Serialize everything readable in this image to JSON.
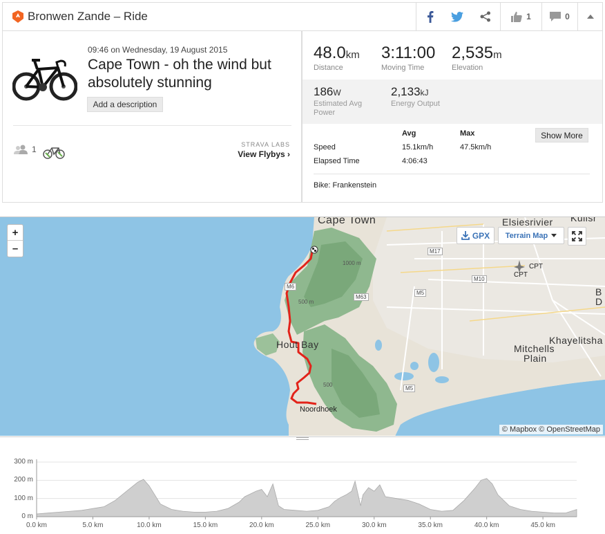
{
  "header": {
    "title": "Bronwen Zande – Ride",
    "kudos_count": "1",
    "comments_count": "0"
  },
  "activity": {
    "date": "09:46 on Wednesday, 19 August 2015",
    "name": "Cape Town - oh the wind but absolutely stunning",
    "add_description": "Add a description",
    "athlete_count": "1",
    "labs_label": "STRAVA LABS",
    "flyby_label": "View Flybys ›"
  },
  "stats": {
    "distance": {
      "value": "48.0",
      "unit": "km",
      "label": "Distance"
    },
    "moving_time": {
      "value": "3:11:00",
      "label": "Moving Time"
    },
    "elevation": {
      "value": "2,535",
      "unit": "m",
      "label": "Elevation"
    },
    "power": {
      "value": "186",
      "unit": "W",
      "label": "Estimated Avg Power"
    },
    "energy": {
      "value": "2,133",
      "unit": "kJ",
      "label": "Energy Output"
    }
  },
  "more_table": {
    "col_avg": "Avg",
    "col_max": "Max",
    "speed_label": "Speed",
    "speed_avg": "15.1km/h",
    "speed_max": "47.5km/h",
    "elapsed_label": "Elapsed Time",
    "elapsed_avg": "4:06:43",
    "show_more": "Show More",
    "bike": "Bike: Frankenstein"
  },
  "map": {
    "zoom_in": "+",
    "zoom_out": "–",
    "gpx": "GPX",
    "terrain": "Terrain Map",
    "attribution": "© Mapbox © OpenStreetMap",
    "labels": {
      "cape_town": "Cape Town",
      "elsiesrivier": "Elsiesrivier",
      "kuilsr": "Kuilsr",
      "hout_bay": "Hout Bay",
      "noordhoek": "Noordhoek",
      "khayelitsha": "Khayelitsha",
      "mitchells": "Mitchells",
      "plain": "Plain",
      "cpt1": "CPT",
      "cpt2": "CPT",
      "b": "B",
      "d": "D",
      "m17": "M17",
      "m10": "M10",
      "m5": "M5",
      "m5b": "M5",
      "m63": "M63",
      "m6": "M6",
      "e1000": "1000 m",
      "e500a": "500 m",
      "e500b": "500"
    }
  },
  "elevation_chart": {
    "y_ticks": [
      "300 m",
      "200 m",
      "100 m",
      "0 m"
    ],
    "x_ticks": [
      "0.0 km",
      "5.0 km",
      "10.0 km",
      "15.0 km",
      "20.0 km",
      "25.0 km",
      "30.0 km",
      "35.0 km",
      "40.0 km",
      "45.0 km"
    ],
    "y_max": 300,
    "x_max_km": 48.0,
    "profile_km": [
      0,
      1,
      2,
      3,
      4,
      5,
      6,
      7,
      8,
      9,
      9.5,
      10,
      10.5,
      11,
      12,
      13,
      14,
      15,
      16,
      17,
      18,
      18.5,
      19,
      19.5,
      20,
      20.5,
      21,
      21.5,
      22,
      23,
      24,
      25,
      26,
      26.5,
      27,
      27.5,
      28,
      28.3,
      28.8,
      29,
      29.5,
      30,
      30.5,
      31,
      32,
      33,
      34,
      35,
      36,
      37,
      38,
      39,
      39.5,
      40,
      40.5,
      41,
      42,
      43,
      44,
      45,
      46,
      47,
      48
    ],
    "profile_m": [
      15,
      20,
      25,
      30,
      35,
      45,
      55,
      90,
      140,
      190,
      205,
      170,
      120,
      70,
      40,
      30,
      25,
      25,
      30,
      45,
      80,
      110,
      125,
      140,
      150,
      110,
      180,
      60,
      40,
      35,
      30,
      35,
      55,
      85,
      105,
      120,
      140,
      195,
      60,
      120,
      160,
      140,
      175,
      110,
      100,
      90,
      70,
      40,
      30,
      35,
      90,
      160,
      200,
      210,
      180,
      120,
      60,
      40,
      30,
      25,
      20,
      20,
      40
    ]
  }
}
